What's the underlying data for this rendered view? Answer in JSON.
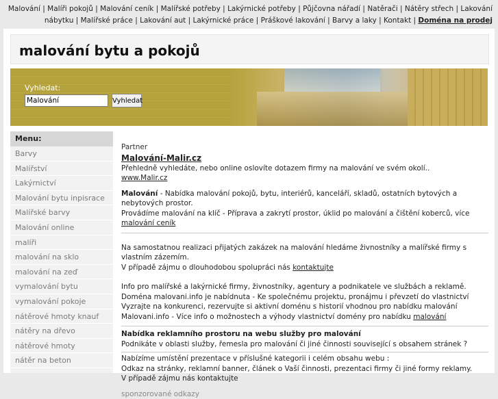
{
  "topnav": {
    "items": [
      "Malování",
      "Malíři pokojů",
      "Malování ceník",
      "Malířské potřeby",
      "Lakýrnické potřeby",
      "Půjčovna nářadí",
      "Natěrači",
      "Nátěry střech",
      "Lakování nábytku",
      "Malířské práce",
      "Lakování aut",
      "Lakýrnické práce",
      "Práškové lakování",
      "Barvy a laky",
      "Kontakt"
    ],
    "last": "Doména na prodej"
  },
  "header": {
    "title": "malování bytu a pokojů"
  },
  "search": {
    "label": "Vyhledat:",
    "value": "Malování",
    "button": "Vyhledat"
  },
  "sidebar": {
    "title": "Menu:",
    "items": [
      "Barvy",
      "Malířství",
      "Lakýrnictví",
      "Malování bytu inpisrace",
      "Malířské barvy",
      "Malování online",
      "malíři",
      "malování na sklo",
      "malování na zeď",
      "vymalování bytu",
      "vymalování pokoje",
      "nátěrové hmoty knauf",
      "nátěry na dřevo",
      "nátěrové hmoty",
      "nátěr na beton"
    ]
  },
  "content": {
    "partner_label": "Partner",
    "partner_title": "Malování-Malir.cz",
    "partner_desc": "Přehledně vyhledáte, nebo online oslovíte dotazem firmy na malování ve svém okolí..",
    "partner_url": "www.Malir.cz",
    "p1_bold": "Malování",
    "p1_text": " - Nabídka malování pokojů, bytu, interiérů, kanceláří, skladů, ostatních bytových a nebytových prostor.",
    "p1_line2": "Provádíme malování na klíč - Příprava a zakrytí prostor, úklid po malování a čištění koberců, více ",
    "p1_link": "malování ceník",
    "p2_line1": "Na samostatnou realizaci přijatých zakázek na malování hledáme živnostníky a malířské firmy s vlastním zázemím.",
    "p2_line2": "V případě zájmu o dlouhodobou spolupráci nás ",
    "p2_link": "kontaktujte",
    "p3_line1": "Info pro malířské a lakýrnické firmy, živnostníky, agentury a podnikatele ve službách a reklamě.",
    "p3_line2": "Doména malovani.info je nabídnuta - Ke společnému projektu, pronájmu i převzetí do vlastnictví",
    "p3_line3": "Vyzrajte na konkurenci, rezervujte si aktivní doménu s historií vhodnou pro nabídku malování",
    "p3_line4": "Malovani.info - Více info o možnostech a výhody vlastnictví domény pro nabídku ",
    "p3_link": "malování",
    "p4_title": "Nabídka reklamního prostoru na webu služby pro malování",
    "p4_text": "Podnikáte v oblasti služby, řemesla pro malování či jiné činnosti související s obsahem stránek ?",
    "p5_line1": "Nabízíme umístění prezentace v příslušné kategorii i celém obsahu webu :",
    "p5_line2": "Odkaz na stránky, reklamní banner, článek o Vaší činnosti, prezentaci firmy či jiné formy reklamy.",
    "p5_line3": "V případě zájmu nás kontaktujte",
    "sponsored": "sponzorované odkazy"
  }
}
